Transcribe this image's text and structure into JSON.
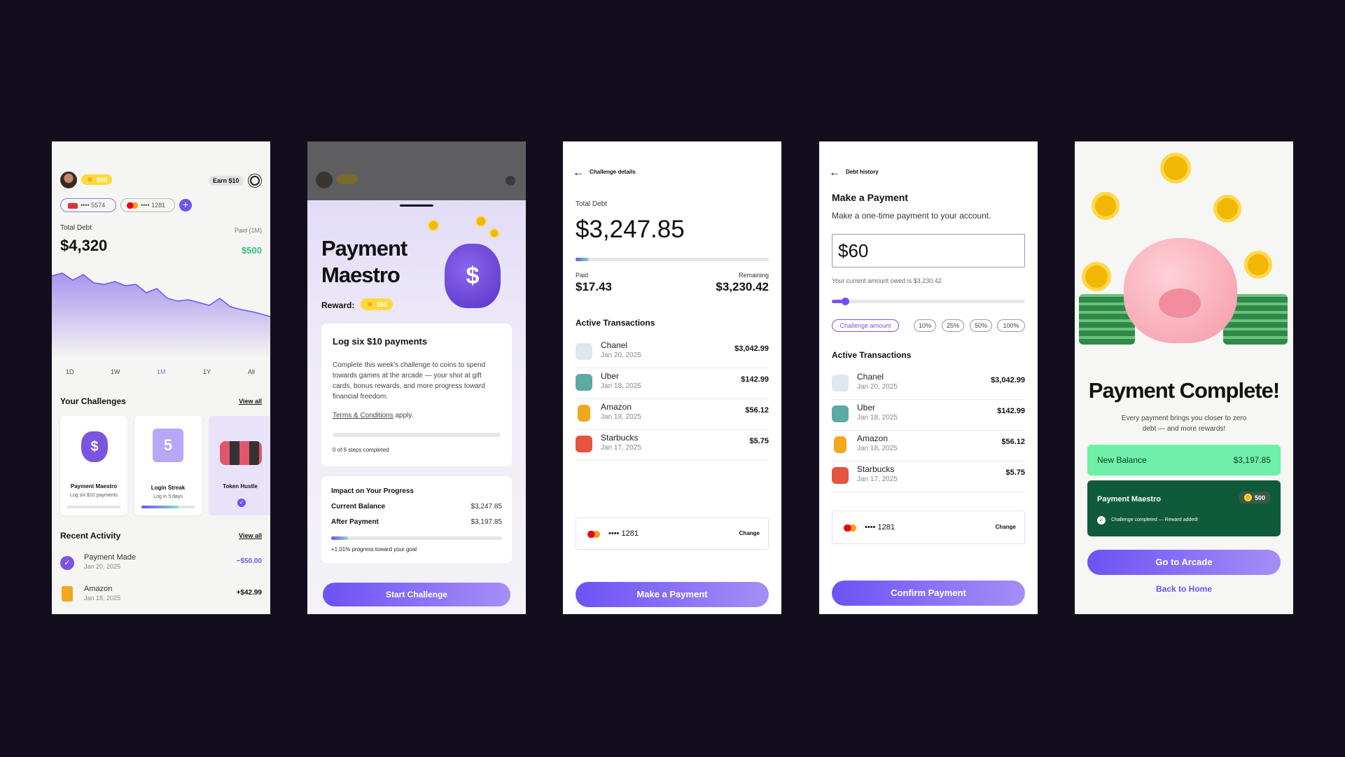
{
  "s1": {
    "coins": "500",
    "earn": "Earn $10",
    "card1": "•••• 5574",
    "card2": "•••• 1281",
    "total_debt_label": "Total Debt",
    "total_debt": "$4,320",
    "paid_label": "Paid (1M)",
    "paid": "$500",
    "ranges": [
      "1D",
      "1W",
      "1M",
      "1Y",
      "All"
    ],
    "challenges_title": "Your Challenges",
    "view_all": "View all",
    "challenges": [
      {
        "name": "Payment Maestro",
        "desc": "Log six $10 payments"
      },
      {
        "name": "Login Streak",
        "desc": "Log in 5 days"
      },
      {
        "name": "Token Hustle",
        "desc": ""
      }
    ],
    "activity_title": "Recent Activity",
    "view_all2": "View all",
    "activity": [
      {
        "name": "Payment Made",
        "date": "Jan 20, 2025",
        "amount": "−$50.00"
      },
      {
        "name": "Amazon",
        "date": "Jan 18, 2025",
        "amount": "+$42.99"
      }
    ]
  },
  "s2": {
    "title1": "Payment",
    "title2": "Maestro",
    "reward_label": "Reward:",
    "reward": "500",
    "card_title": "Log six $10 payments",
    "card_body": "Complete this week's challenge to coins to spend towards games at the arcade — your shot at gift cards, bonus rewards, and more progress toward financial freedom.",
    "terms": "Terms & Conditions",
    "terms_tail": " apply.",
    "steps": "0 of 6 steps completed",
    "impact_title": "Impact on Your Progress",
    "current_label": "Current Balance",
    "current": "$3,247.85",
    "after_label": "After Payment",
    "after": "$3,197.85",
    "progress_note": "+1.01% progress toward your goal",
    "cta": "Start Challenge"
  },
  "s3": {
    "back": "Challenge details",
    "total_label": "Total Debt",
    "total": "$3,247.85",
    "paid_label": "Paid",
    "paid": "$17.43",
    "remaining_label": "Remaining",
    "remaining": "$3,230.42",
    "tx_title": "Active Transactions",
    "tx": [
      {
        "name": "Chanel",
        "date": "Jan 20, 2025",
        "amount": "$3,042.99"
      },
      {
        "name": "Uber",
        "date": "Jan 18, 2025",
        "amount": "$142.99"
      },
      {
        "name": "Amazon",
        "date": "Jan 18, 2025",
        "amount": "$56.12"
      },
      {
        "name": "Starbucks",
        "date": "Jan 17, 2025",
        "amount": "$5.75"
      }
    ],
    "card": "•••• 1281",
    "change": "Change",
    "cta": "Make a Payment"
  },
  "s4": {
    "back": "Debt history",
    "title": "Make a Payment",
    "subtitle": "Make a one-time payment to your account.",
    "amount": "$60",
    "owed": "Your current amount owed is $3,230.42",
    "chips": [
      "Challenge amount",
      "10%",
      "25%",
      "50%",
      "100%"
    ],
    "tx_title": "Active Transactions",
    "tx": [
      {
        "name": "Chanel",
        "date": "Jan 20, 2025",
        "amount": "$3,042.99"
      },
      {
        "name": "Uber",
        "date": "Jan 18, 2025",
        "amount": "$142.99"
      },
      {
        "name": "Amazon",
        "date": "Jan 18, 2025",
        "amount": "$56.12"
      },
      {
        "name": "Starbucks",
        "date": "Jan 17, 2025",
        "amount": "$5.75"
      }
    ],
    "card": "•••• 1281",
    "change": "Change",
    "cta": "Confirm Payment"
  },
  "s5": {
    "title": "Payment Complete!",
    "subtitle": "Every payment brings you closer to zero debt — and more rewards!",
    "balance_label": "New Balance",
    "balance": "$3,197.85",
    "challenge": "Payment Maestro",
    "coins": "500",
    "challenge_note": "Challenge completed — Reward added!",
    "cta": "Go to Arcade",
    "secondary": "Back to Home"
  },
  "colors": {
    "purple": "#6d52f5",
    "green": "#2fc27a",
    "mint": "#6ef0a8",
    "dark_green": "#0f5a3a",
    "coin": "#f2b705"
  }
}
